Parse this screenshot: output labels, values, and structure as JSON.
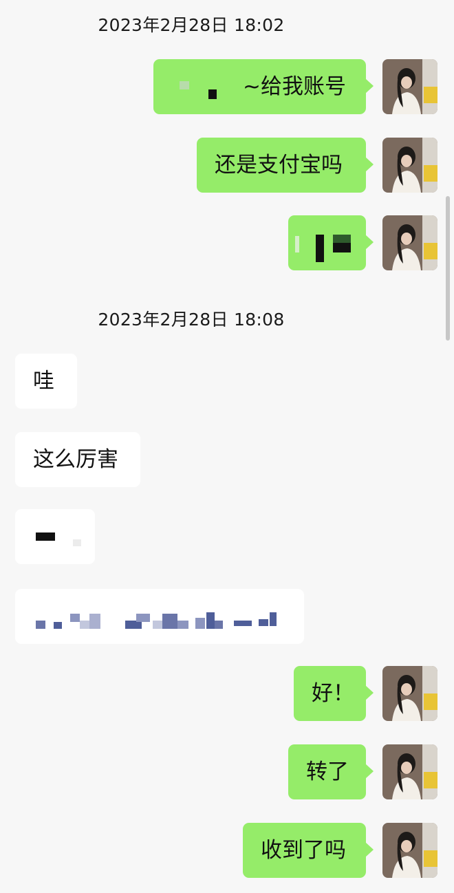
{
  "timestamps": [
    "2023年2月28日 18:02",
    "2023年2月28日 18:08"
  ],
  "messages": {
    "m1": "~给我账号",
    "m2": "还是支付宝吗",
    "m5": "哇",
    "m6": "这么厉害",
    "m9": "好！",
    "m10": "转了",
    "m11": "收到了吗"
  },
  "colors": {
    "self_bubble": "#95ec69",
    "other_bubble": "#ffffff",
    "background": "#f7f7f7"
  }
}
